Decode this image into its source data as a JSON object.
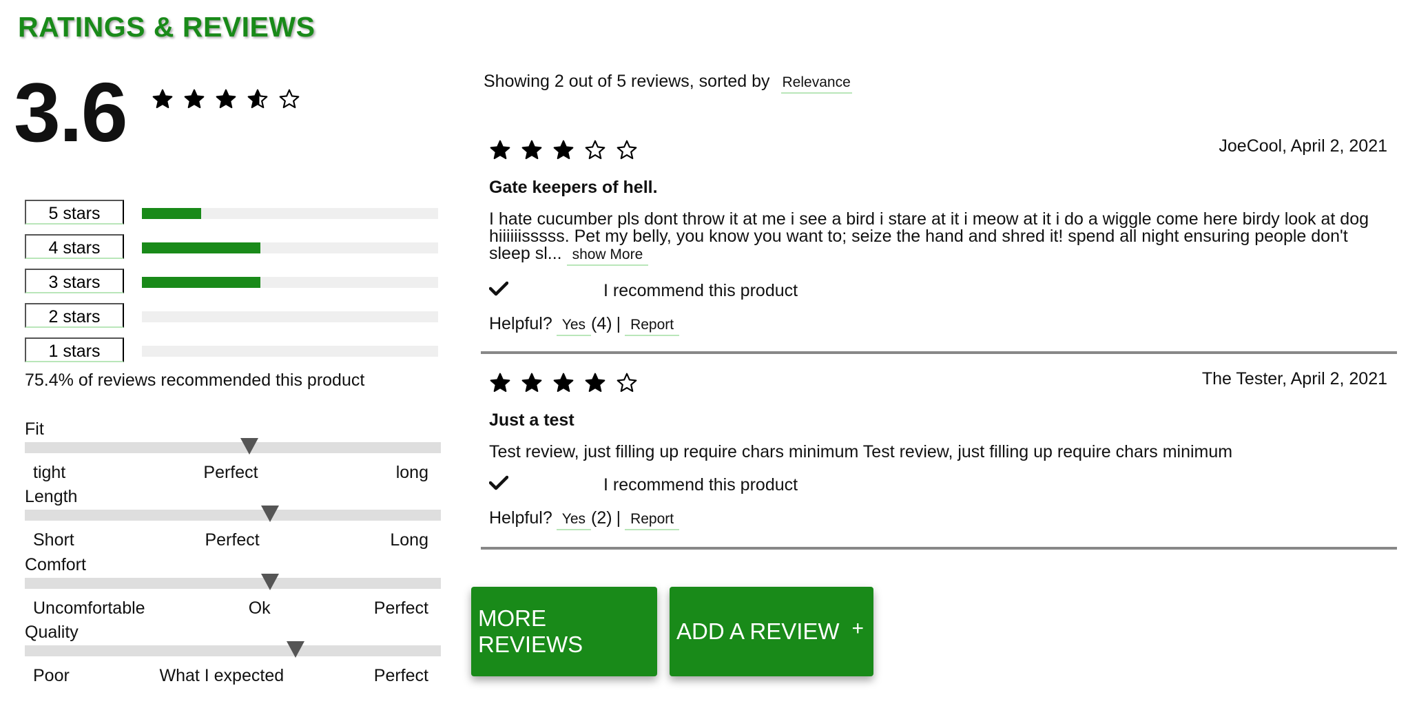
{
  "heading": "RATINGS & REVIEWS",
  "summary": {
    "average": "3.6",
    "average_value": 3.6,
    "recommend_text": "75.4% of reviews recommended this product"
  },
  "breakdown": [
    {
      "label": "5 stars",
      "fraction": 0.2
    },
    {
      "label": "4 stars",
      "fraction": 0.4
    },
    {
      "label": "3 stars",
      "fraction": 0.4
    },
    {
      "label": "2 stars",
      "fraction": 0
    },
    {
      "label": "1 stars",
      "fraction": 0
    }
  ],
  "characteristics": [
    {
      "name": "Fit",
      "scale": [
        "tight",
        "Perfect",
        "long"
      ],
      "value": 0.54
    },
    {
      "name": "Length",
      "scale": [
        "Short",
        "Perfect",
        "Long"
      ],
      "value": 0.59
    },
    {
      "name": "Comfort",
      "scale": [
        "Uncomfortable",
        "Ok",
        "Perfect"
      ],
      "value": 0.59
    },
    {
      "name": "Quality",
      "scale": [
        "Poor",
        "What I expected",
        "Perfect"
      ],
      "value": 0.65
    }
  ],
  "list_header": {
    "showing_text": "Showing 2 out of 5 reviews, sorted by",
    "sort_value": "Relevance"
  },
  "reviews": [
    {
      "rating": 3,
      "author_date": "JoeCool, April 2, 2021",
      "title": "Gate keepers of hell.",
      "body": "I hate cucumber pls dont throw it at me i see a bird i stare at it i meow at it i do a wiggle come here birdy look at dog hiiiiiisssss. Pet my belly, you know you want to; seize the hand and shred it! spend all night ensuring people don't sleep sl...",
      "show_more": "show More",
      "recommend": "I recommend this product",
      "helpful_label": "Helpful?",
      "yes_label": "Yes",
      "yes_count": "(4)",
      "separator": "|",
      "report_label": "Report"
    },
    {
      "rating": 4,
      "author_date": "The Tester, April 2, 2021",
      "title": "Just a test",
      "body": "Test review, just filling up require chars minimum Test review, just filling up require chars minimum",
      "recommend": "I recommend this product",
      "helpful_label": "Helpful?",
      "yes_label": "Yes",
      "yes_count": "(2)",
      "separator": "|",
      "report_label": "Report"
    }
  ],
  "actions": {
    "more_reviews": "MORE REVIEWS",
    "add_review": "ADD A REVIEW",
    "add_icon": "+"
  },
  "colors": {
    "accent": "#198a19",
    "underline": "#b9e6b9",
    "divider": "#888888"
  }
}
